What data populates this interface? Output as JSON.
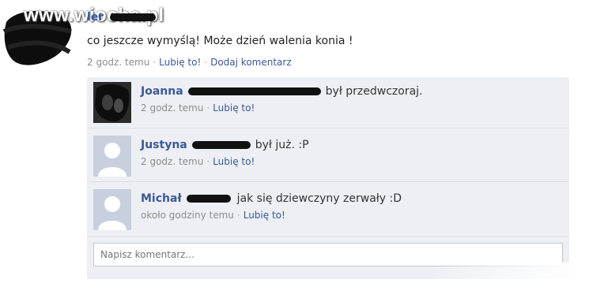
{
  "watermark": "www.wiocha.pl",
  "post": {
    "author_visible": "ler",
    "text": "co jeszcze wymyślą! Może dzień walenia konia !",
    "time": "2 godz. temu",
    "like_label": "Lubię to!",
    "comment_label": "Dodaj komentarz"
  },
  "comments": [
    {
      "name": "Joanna",
      "text": "był przedwczoraj.",
      "time": "2 godz. temu",
      "like_label": "Lubię to!"
    },
    {
      "name": "Justyna",
      "text": "był już. :P",
      "time": "2 godz. temu",
      "like_label": "Lubię to!"
    },
    {
      "name": "Michał",
      "text": "jak się dziewczyny zerwały :D",
      "time": "około godziny temu",
      "like_label": "Lubię to!"
    }
  ],
  "reply_placeholder": "Napisz komentarz..."
}
